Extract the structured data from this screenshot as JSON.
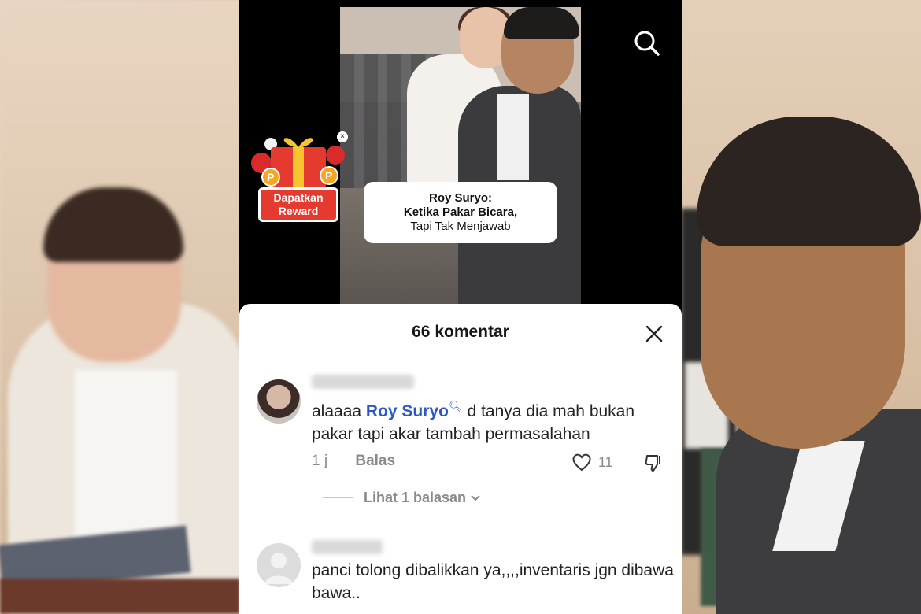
{
  "status_bar": {
    "left": "",
    "right": ""
  },
  "video": {
    "caption_title": "Roy Suryo:",
    "caption_line2": "Ketika Pakar Bicara,",
    "caption_line3": "Tapi Tak Menjawab"
  },
  "reward_widget": {
    "label_line1": "Dapatkan",
    "label_line2": "Reward",
    "close": "×"
  },
  "comments_sheet": {
    "title": "66 komentar",
    "comments": [
      {
        "text_before": "alaaaa ",
        "mention": "Roy Suryo",
        "text_after": " d tanya dia mah bukan pakar tapi akar tambah permasalahan",
        "time": "1 j",
        "reply_label": "Balas",
        "likes": "11",
        "view_replies": "Lihat 1 balasan"
      },
      {
        "text": "panci tolong dibalikkan ya,,,,inventaris jgn dibawa bawa.."
      }
    ]
  },
  "icons": [
    "search-icon",
    "close-icon",
    "heart-icon",
    "dislike-icon",
    "chevron-down-icon",
    "gift-icon"
  ]
}
